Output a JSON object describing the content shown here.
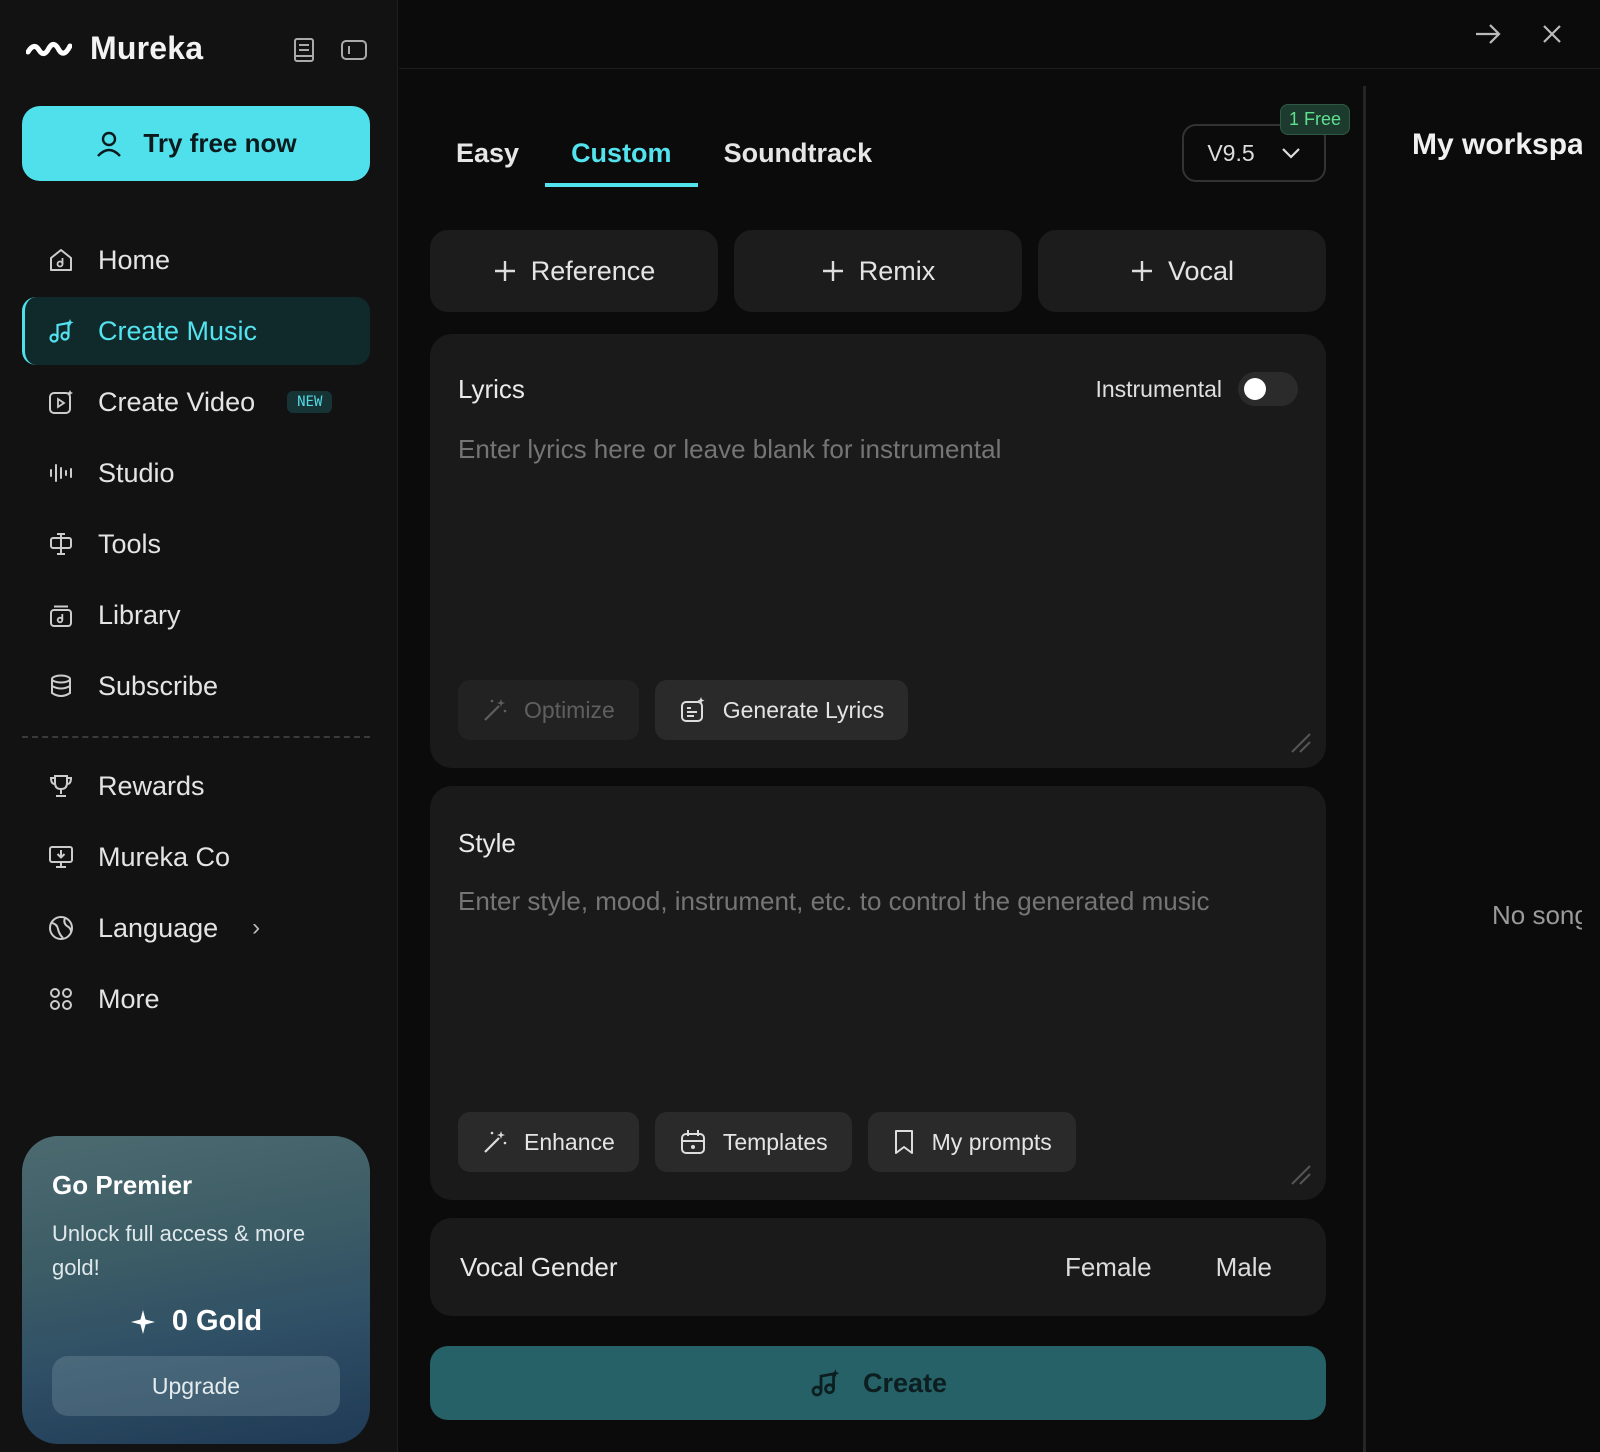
{
  "app": {
    "name": "Mureka"
  },
  "sidebar": {
    "try_label": "Try free now",
    "items": [
      {
        "label": "Home",
        "icon": "home-music-icon"
      },
      {
        "label": "Create Music",
        "icon": "music-sparkle-icon",
        "active": true
      },
      {
        "label": "Create Video",
        "icon": "video-icon",
        "badge": "NEW"
      },
      {
        "label": "Studio",
        "icon": "waveform-icon"
      },
      {
        "label": "Tools",
        "icon": "tools-icon"
      },
      {
        "label": "Library",
        "icon": "library-icon"
      },
      {
        "label": "Subscribe",
        "icon": "coins-icon"
      },
      {
        "label": "Rewards",
        "icon": "trophy-icon"
      },
      {
        "label": "Mureka Co",
        "icon": "monitor-download-icon"
      },
      {
        "label": "Language",
        "icon": "globe-icon"
      },
      {
        "label": "More",
        "icon": "grid-icon"
      }
    ],
    "premier": {
      "title": "Go Premier",
      "subtitle": "Unlock full access & more gold!",
      "gold": "0 Gold",
      "upgrade_label": "Upgrade"
    }
  },
  "main": {
    "tabs": [
      "Easy",
      "Custom",
      "Soundtrack"
    ],
    "active_tab": "Custom",
    "version": "V9.5",
    "free_badge": "1 Free",
    "chips": [
      "Reference",
      "Remix",
      "Vocal"
    ],
    "lyrics": {
      "title": "Lyrics",
      "instrumental_label": "Instrumental",
      "placeholder": "Enter lyrics here or leave blank for instrumental",
      "optimize_label": "Optimize",
      "generate_label": "Generate Lyrics"
    },
    "style": {
      "title": "Style",
      "placeholder": "Enter style, mood, instrument, etc. to control the generated music",
      "enhance_label": "Enhance",
      "templates_label": "Templates",
      "prompts_label": "My prompts"
    },
    "vocal_gender": {
      "title": "Vocal Gender",
      "options": [
        "Female",
        "Male"
      ]
    },
    "create_label": "Create"
  },
  "workspace": {
    "title": "My workspace",
    "empty": "No songs"
  },
  "colors": {
    "accent": "#4fe0ec",
    "create_button": "#256166",
    "free_badge": "#5ee08f"
  }
}
